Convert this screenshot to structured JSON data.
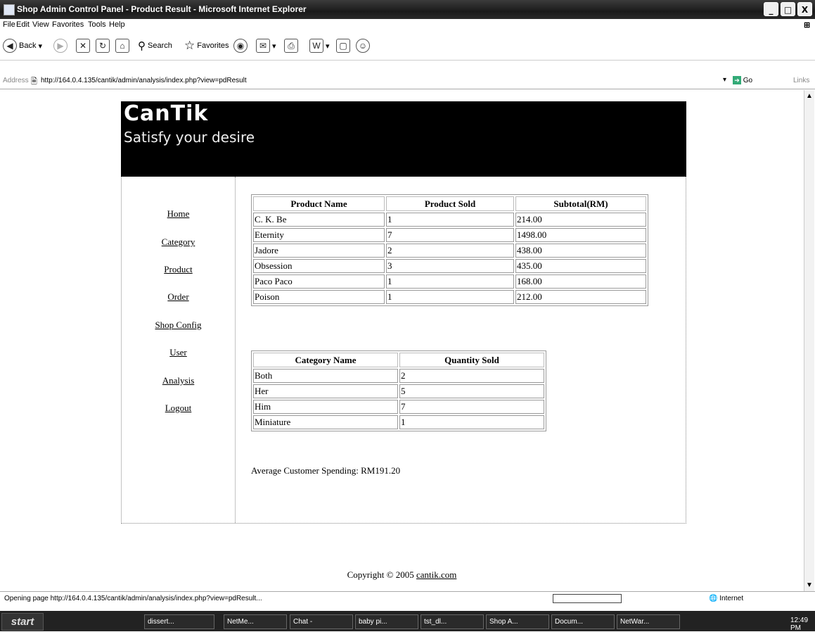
{
  "window": {
    "title": "Shop Admin Control Panel - Product Result - Microsoft Internet Explorer",
    "minimize": "_",
    "maximize": "□",
    "close": "X"
  },
  "menu": [
    "File",
    "Edit",
    "View",
    "Favorites",
    "Tools",
    "Help"
  ],
  "toolbar": {
    "back": "Back",
    "search": "Search",
    "favorites": "Favorites"
  },
  "address": {
    "label": "Address",
    "url": "http://164.0.4.135/cantik/admin/analysis/index.php?view=pdResult",
    "go": "Go",
    "links": "Links"
  },
  "site": {
    "logo": "CanTik",
    "tagline": "Satisfy your desire"
  },
  "nav": [
    "Home",
    "Category",
    "Product",
    "Order",
    "Shop Config",
    "User",
    "Analysis",
    "Logout"
  ],
  "product_table": {
    "headers": [
      "Product Name",
      "Product Sold",
      "Subtotal(RM)"
    ],
    "rows": [
      [
        "C. K. Be",
        "1",
        "214.00"
      ],
      [
        "Eternity",
        "7",
        "1498.00"
      ],
      [
        "Jadore",
        "2",
        "438.00"
      ],
      [
        "Obsession",
        "3",
        "435.00"
      ],
      [
        "Paco Paco",
        "1",
        "168.00"
      ],
      [
        "Poison",
        "1",
        "212.00"
      ]
    ]
  },
  "category_table": {
    "headers": [
      "Category Name",
      "Quantity Sold"
    ],
    "rows": [
      [
        "Both",
        "2"
      ],
      [
        "Her",
        "5"
      ],
      [
        "Him",
        "7"
      ],
      [
        "Miniature",
        "1"
      ]
    ]
  },
  "average_spending": "Average Customer Spending: RM191.20",
  "footer": {
    "copyright_prefix": "Copyright © 2005",
    "link": "cantik.com"
  },
  "status": {
    "message": "Opening page http://164.0.4.135/cantik/admin/analysis/index.php?view=pdResult...",
    "zone": "Internet"
  },
  "taskbar": {
    "start": "start",
    "tasks": [
      "dissert...",
      "NetMe...",
      "Chat -",
      "baby pi...",
      "tst_dl...",
      "Shop A...",
      "Docum...",
      "NetWar..."
    ],
    "clock": "12:49 PM"
  }
}
